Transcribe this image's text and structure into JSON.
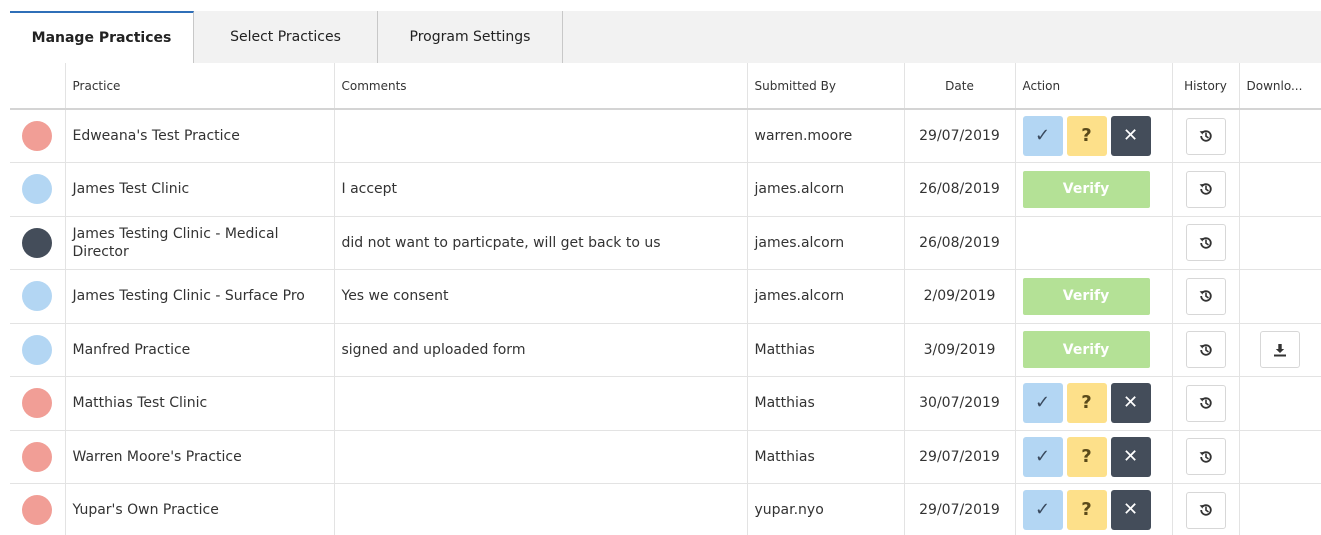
{
  "tabs": [
    {
      "label": "Manage Practices",
      "active": true
    },
    {
      "label": "Select Practices",
      "active": false
    },
    {
      "label": "Program Settings",
      "active": false
    }
  ],
  "columns": {
    "practice": "Practice",
    "comments": "Comments",
    "submitted_by": "Submitted By",
    "date": "Date",
    "action": "Action",
    "history": "History",
    "download": "Downlo..."
  },
  "action_labels": {
    "accept": "✓",
    "query": "?",
    "reject": "✕",
    "verify": "Verify"
  },
  "status_colors": {
    "pending": "#f19e96",
    "accepted": "#b3d6f3",
    "declined": "#444d5a"
  },
  "icons": {
    "history": "history-icon",
    "download": "download-icon"
  },
  "rows": [
    {
      "status": "pending",
      "practice": "Edweana's Test Practice",
      "comments": "",
      "submitted_by": "warren.moore",
      "date": "29/07/2019",
      "action": "buttons",
      "download": false
    },
    {
      "status": "accepted",
      "practice": "James Test Clinic",
      "comments": "I accept",
      "submitted_by": "james.alcorn",
      "date": "26/08/2019",
      "action": "verify",
      "download": false
    },
    {
      "status": "declined",
      "practice": "James Testing Clinic - Medical Director",
      "comments": "did not want to particpate, will get back to us",
      "submitted_by": "james.alcorn",
      "date": "26/08/2019",
      "action": "none",
      "download": false
    },
    {
      "status": "accepted",
      "practice": "James Testing Clinic - Surface Pro",
      "comments": "Yes we consent",
      "submitted_by": "james.alcorn",
      "date": "2/09/2019",
      "action": "verify",
      "download": false
    },
    {
      "status": "accepted",
      "practice": "Manfred Practice",
      "comments": "signed and uploaded form",
      "submitted_by": "Matthias",
      "date": "3/09/2019",
      "action": "verify",
      "download": true
    },
    {
      "status": "pending",
      "practice": "Matthias Test Clinic",
      "comments": "",
      "submitted_by": "Matthias",
      "date": "30/07/2019",
      "action": "buttons",
      "download": false
    },
    {
      "status": "pending",
      "practice": "Warren Moore's Practice",
      "comments": "",
      "submitted_by": "Matthias",
      "date": "29/07/2019",
      "action": "buttons",
      "download": false
    },
    {
      "status": "pending",
      "practice": "Yupar's Own Practice",
      "comments": "",
      "submitted_by": "yupar.nyo",
      "date": "29/07/2019",
      "action": "buttons",
      "download": false
    }
  ]
}
